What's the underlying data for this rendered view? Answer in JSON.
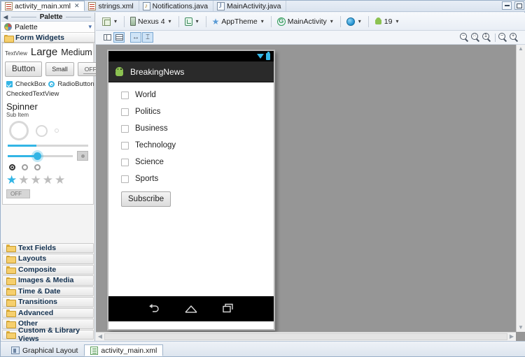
{
  "window": {
    "minimize_label": "Minimize",
    "maximize_label": "Maximize"
  },
  "editor_tabs": [
    {
      "label": "activity_main.xml",
      "icon": "xml-file-icon",
      "active": true,
      "close": "✕"
    },
    {
      "label": "strings.xml",
      "icon": "xml-file-icon",
      "active": false
    },
    {
      "label": "Notifications.java",
      "icon": "java-notification-file-icon",
      "active": false
    },
    {
      "label": "MainActivity.java",
      "icon": "java-file-icon",
      "active": false
    }
  ],
  "palette": {
    "panel_title": "Palette",
    "selector_label": "Palette",
    "selector_icon": "palette-icon",
    "collapse_icon": "collapse-left-icon",
    "dropdown_icon": "chevron-down-icon",
    "group_title": "Form Widgets",
    "widgets": {
      "textview_label": "TextView",
      "large_label": "Large",
      "medium_label": "Medium",
      "small_label": "Small",
      "button_label": "Button",
      "small_button_label": "Small",
      "off_button_label": "OFF",
      "checkbox_label": "CheckBox",
      "radiobutton_label": "RadioButton",
      "checkedtextview_label": "CheckedTextView",
      "spinner_label": "Spinner",
      "spinner_sub_label": "Sub Item",
      "switch_off_label": "OFF"
    },
    "categories": [
      {
        "label": "Text Fields"
      },
      {
        "label": "Layouts"
      },
      {
        "label": "Composite"
      },
      {
        "label": "Images & Media"
      },
      {
        "label": "Time & Date"
      },
      {
        "label": "Transitions"
      },
      {
        "label": "Advanced"
      },
      {
        "label": "Other"
      },
      {
        "label": "Custom & Library Views"
      }
    ]
  },
  "toolbar": {
    "config_icon": "configuration-icon",
    "device_label": "Nexus 4",
    "device_icon": "device-icon",
    "orientation_icon": "orientation-rotate-icon",
    "theme_label": "AppTheme",
    "theme_icon": "theme-star-icon",
    "activity_label": "MainActivity",
    "activity_icon": "activity-circle-icon",
    "locale_icon": "locale-globe-icon",
    "api_label": "19",
    "api_icon": "android-icon",
    "caret": "▾"
  },
  "toolbar2": {
    "toggles": [
      {
        "name": "show-outline-toggle",
        "selected": false
      },
      {
        "name": "show-layout-bounds-toggle",
        "selected": true
      },
      {
        "name": "fit-width-toggle",
        "selected": true,
        "glyph": "↔"
      },
      {
        "name": "fit-height-toggle",
        "selected": true,
        "glyph": "⌶"
      }
    ],
    "zoom_buttons": [
      {
        "name": "zoom-out-button",
        "sym": "−"
      },
      {
        "name": "zoom-fit-button",
        "sym": "⁙"
      },
      {
        "name": "zoom-actual-size-button",
        "sym": "1"
      },
      {
        "name": "zoom-decrease-button",
        "sym": "−"
      },
      {
        "name": "zoom-increase-button",
        "sym": "+"
      }
    ]
  },
  "preview": {
    "app_title": "BreakingNews",
    "app_icon": "android-app-icon",
    "wifi_icon": "wifi-icon",
    "battery_icon": "battery-icon",
    "checkboxes": [
      {
        "label": "World",
        "checked": false
      },
      {
        "label": "Politics",
        "checked": false
      },
      {
        "label": "Business",
        "checked": false
      },
      {
        "label": "Technology",
        "checked": false
      },
      {
        "label": "Science",
        "checked": false
      },
      {
        "label": "Sports",
        "checked": false
      }
    ],
    "subscribe_label": "Subscribe",
    "nav": {
      "back_icon": "nav-back-icon",
      "home_icon": "nav-home-icon",
      "recents_icon": "nav-recents-icon"
    }
  },
  "bottom_tabs": [
    {
      "label": "Graphical Layout",
      "icon": "graphical-layout-icon",
      "active": false
    },
    {
      "label": "activity_main.xml",
      "icon": "xml-source-icon",
      "active": true
    }
  ],
  "colors": {
    "accent": "#33b5e5",
    "canvas_bg": "#969696",
    "android_green": "#8cc251"
  }
}
